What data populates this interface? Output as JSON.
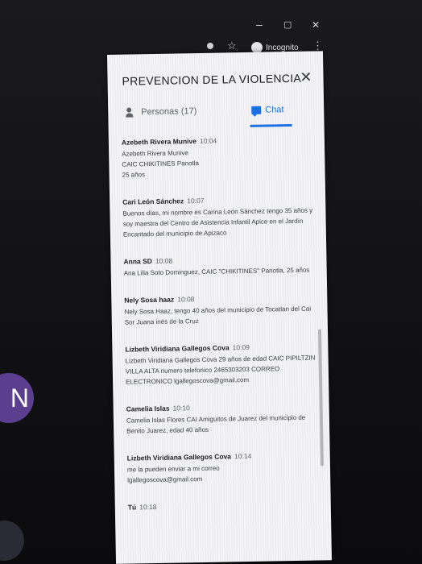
{
  "browser": {
    "minimize_icon": "minimize-icon",
    "restore_icon": "restore-icon",
    "close_icon": "close-icon",
    "profile_label": "Incognito",
    "minimize_glyph": "–",
    "restore_glyph": "▢",
    "close_glyph": "✕",
    "star_glyph": "☆",
    "menu_glyph": "⋮"
  },
  "side": {
    "avatar_letter": "N"
  },
  "panel": {
    "title": "PREVENCION DE LA VIOLENCIA",
    "close_glyph": "✕",
    "tabs": {
      "people_label": "Personas (17)",
      "chat_label": "Chat"
    },
    "messages": [
      {
        "sender": "Azebeth Rivera Munive",
        "time": "10:04",
        "text": "Azebeth Rivera Munive\nCAIC CHIKITINES Panotla\n25 años"
      },
      {
        "sender": "Cari León Sánchez",
        "time": "10:07",
        "text": "Buenos días, mi nombre es Carina León Sánchez tengo 35 años y soy maestra del Centro de Asistencia Infantil Apice en el Jardín Encantado del municipio de Apizaco"
      },
      {
        "sender": "Anna SD",
        "time": "10:08",
        "text": "Ana Lilia Soto Dominguez, CAIC \"CHIKITINES\" Panotla, 25 años"
      },
      {
        "sender": "Nely Sosa haaz",
        "time": "10:08",
        "text": "Nely Sosa Haaz, tengo 40 años del municipio de Tocatlan del Cai Sor Juana inés de la Cruz"
      },
      {
        "sender": "Lizbeth Viridiana Gallegos Cova",
        "time": "10:09",
        "text": "Lizbeth Viridiana Gallegos Cova 29 años de edad CAIC PIPILTZIN VILLA ALTA numero telefonico 2465303203 CORREO ELECTRONICO lgallegoscova@gmail.com"
      },
      {
        "sender": "Camelia Islas",
        "time": "10:10",
        "text": "Camelia Islas Flores CAI Amiguitos de Juarez del municipio de Benito Juarez, edad 40 años"
      },
      {
        "sender": "Lizbeth Viridiana Gallegos Cova",
        "time": "10:14",
        "text": "me la pueden enviar a mi correo\nlgallegoscova@gmail.com"
      },
      {
        "sender": "Tú",
        "time": "10:18",
        "text": ""
      }
    ]
  }
}
